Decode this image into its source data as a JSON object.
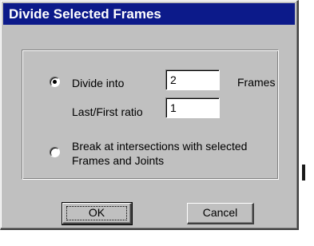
{
  "dialog": {
    "title": "Divide Selected Frames"
  },
  "options": {
    "divide_into": {
      "label": "Divide into",
      "selected": true,
      "count_value": "2",
      "unit_label": "Frames"
    },
    "ratio": {
      "label": "Last/First ratio",
      "value": "1"
    },
    "break_at_intersections": {
      "label_line1": "Break at intersections with selected",
      "label_line2": "Frames and Joints",
      "selected": false
    }
  },
  "buttons": {
    "ok": "OK",
    "cancel": "Cancel"
  },
  "colors": {
    "title_bar": "#0c1a8a",
    "face": "#c0c0c0",
    "title_text": "#ffffff"
  }
}
